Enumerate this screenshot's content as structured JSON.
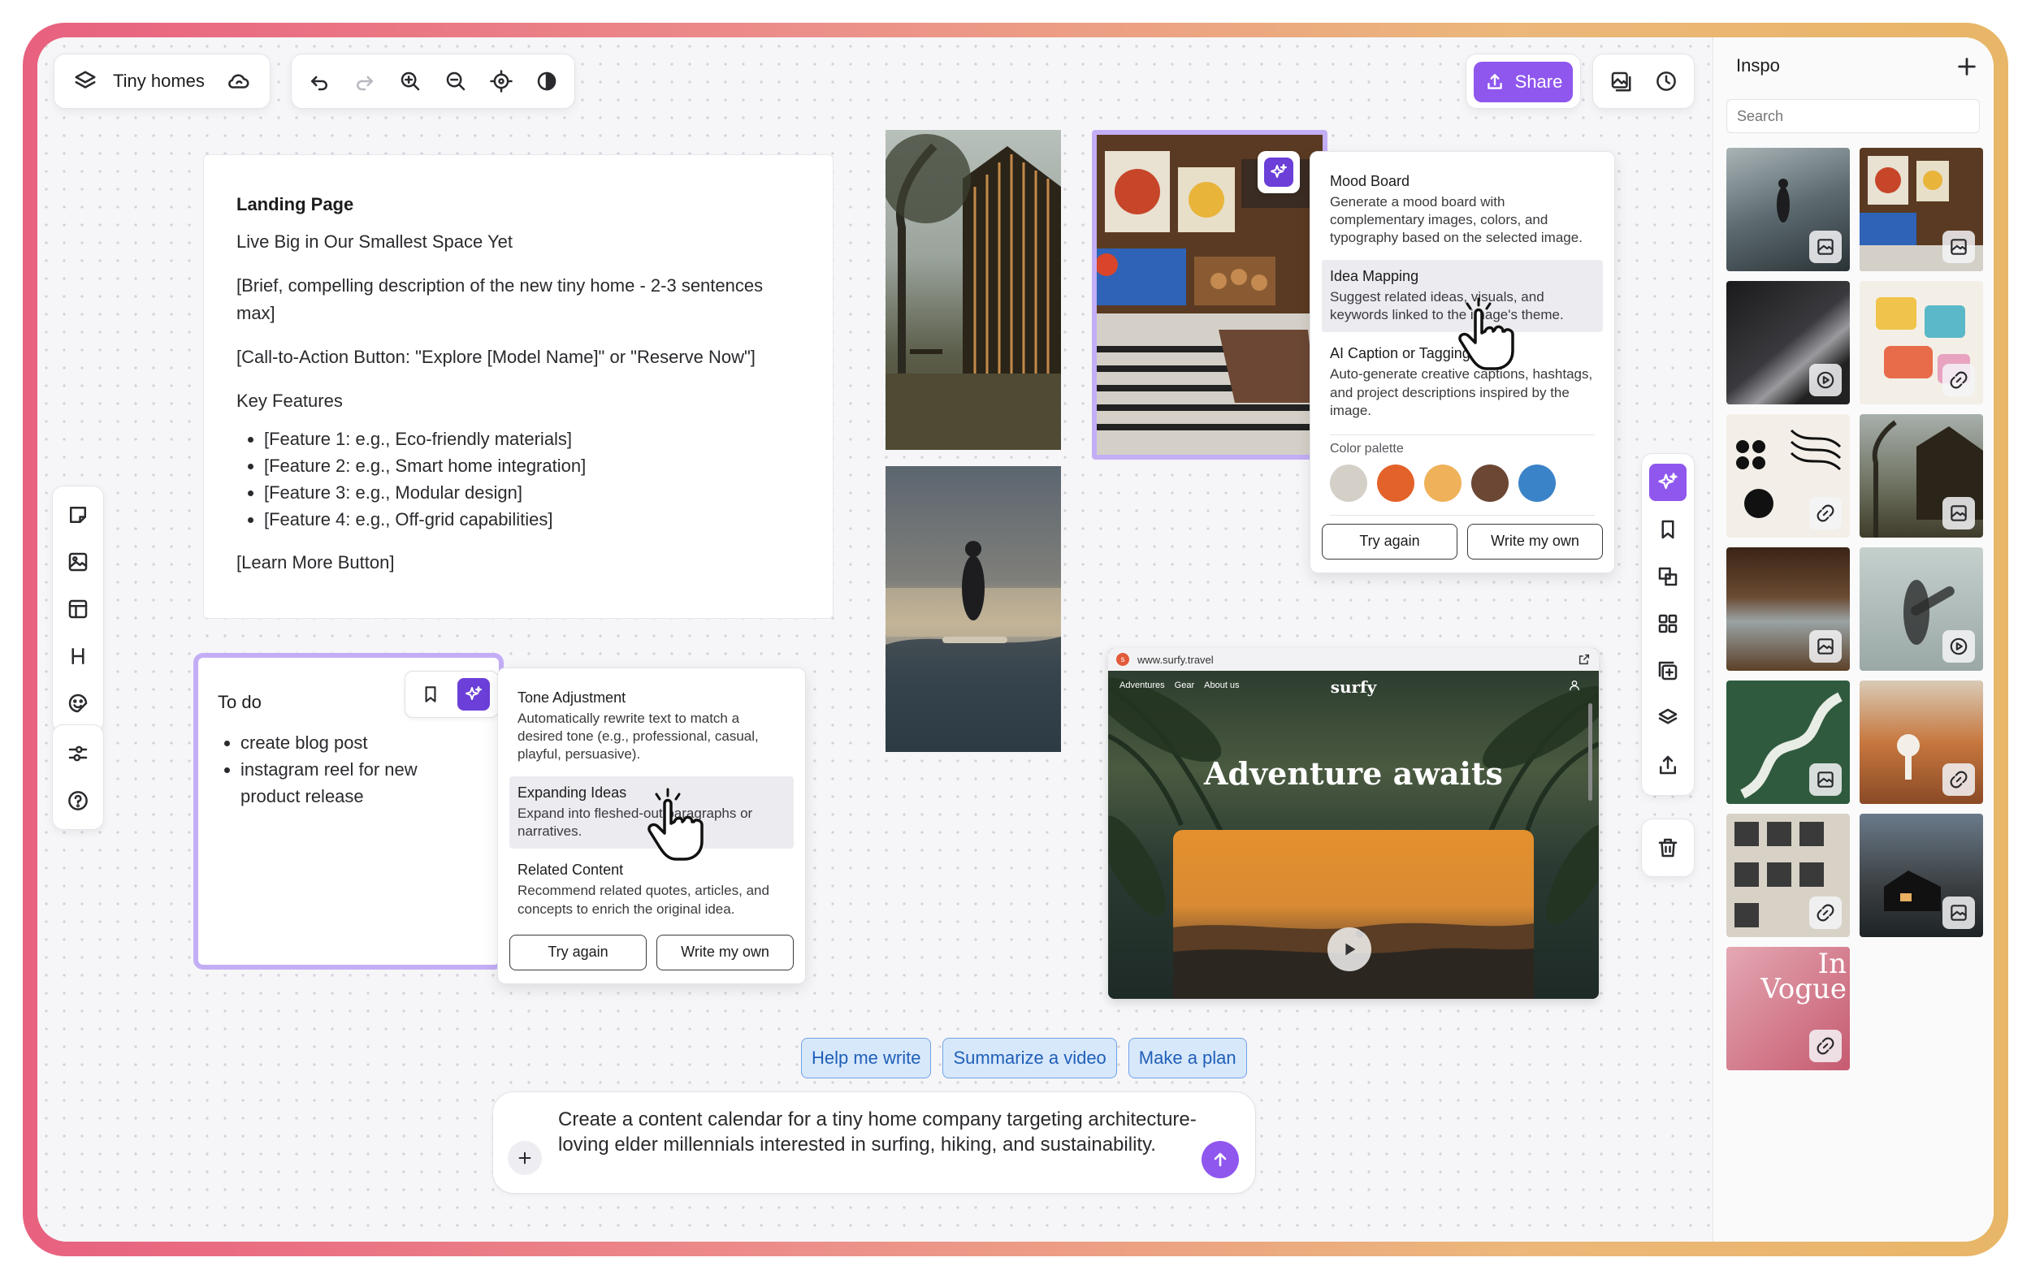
{
  "toolbar": {
    "board_title": "Tiny homes",
    "share_label": "Share"
  },
  "landing_doc": {
    "heading": "Landing Page",
    "tagline": "Live Big in Our Smallest Space Yet",
    "description": "[Brief, compelling description of the new tiny home - 2-3 sentences max]",
    "cta": "[Call-to-Action Button: \"Explore [Model Name]\" or \"Reserve Now\"]",
    "features_heading": "Key Features",
    "features": [
      "[Feature 1: e.g., Eco-friendly materials]",
      "[Feature 2: e.g., Smart home integration]",
      "[Feature 3: e.g., Modular design]",
      "[Feature 4: e.g., Off-grid capabilities]"
    ],
    "learn_more": "[Learn More Button]"
  },
  "todo": {
    "title": "To do",
    "items": [
      "create blog post",
      "instagram reel for new product release"
    ]
  },
  "text_ai_menu": {
    "options": [
      {
        "title": "Tone Adjustment",
        "desc": "Automatically rewrite text to match a desired tone (e.g., professional, casual, playful, persuasive)."
      },
      {
        "title": "Expanding Ideas",
        "desc": "Expand into fleshed-out paragraphs or narratives."
      },
      {
        "title": "Related Content",
        "desc": "Recommend related quotes, articles, and concepts to enrich the original idea."
      }
    ],
    "try_again": "Try again",
    "write_own": "Write my own"
  },
  "image_ai_menu": {
    "options": [
      {
        "title": "Mood Board",
        "desc": "Generate a mood board with complementary images, colors, and typography based on the selected image."
      },
      {
        "title": "Idea Mapping",
        "desc": "Suggest related ideas, visuals, and keywords linked to the image's theme."
      },
      {
        "title": "AI Caption or Tagging",
        "desc": "Auto-generate creative captions, hashtags, and project descriptions inspired by the image."
      }
    ],
    "palette_label": "Color palette",
    "palette": [
      "#d4d0c8",
      "#e3622a",
      "#efb25a",
      "#6b4734",
      "#3b83c8"
    ],
    "try_again": "Try again",
    "write_own": "Write my own"
  },
  "browser_embed": {
    "url": "www.surfy.travel",
    "nav": [
      "Adventures",
      "Gear",
      "About us"
    ],
    "logo": "surfy",
    "hero": "Adventure awaits"
  },
  "chips": [
    "Help me write",
    "Summarize a video",
    "Make a plan"
  ],
  "prompt": {
    "text": "Create a content calendar for a tiny home company targeting architecture-loving elder millennials interested in surfing, hiking, and sustainability."
  },
  "inspo": {
    "title": "Inspo",
    "search_placeholder": "Search",
    "vogue_text": "In Vogue",
    "items": [
      {
        "type": "image-icon"
      },
      {
        "type": "image-icon"
      },
      {
        "type": "play-icon"
      },
      {
        "type": "link-icon"
      },
      {
        "type": "link-icon"
      },
      {
        "type": "image-icon"
      },
      {
        "type": "image-icon"
      },
      {
        "type": "play-icon"
      },
      {
        "type": "image-icon"
      },
      {
        "type": "link-icon"
      },
      {
        "type": "link-icon"
      },
      {
        "type": "image-icon"
      },
      {
        "type": "link-icon"
      }
    ]
  }
}
